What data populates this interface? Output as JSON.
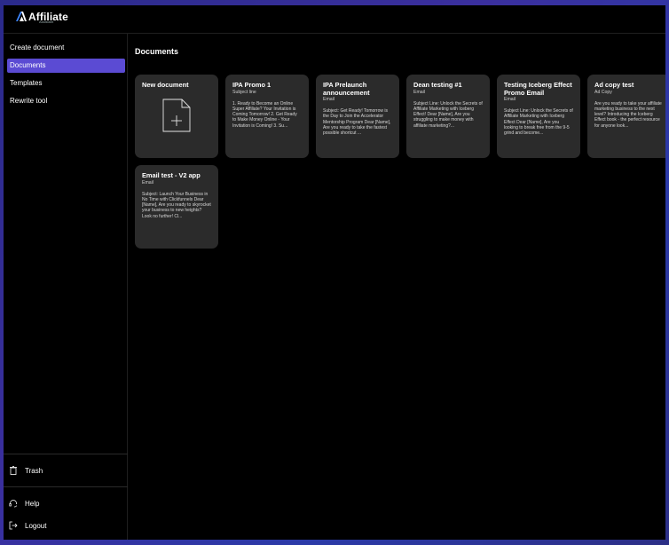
{
  "app": {
    "logo_text": "Affiliate",
    "logo_sub": "Assistant"
  },
  "sidebar": {
    "items": [
      {
        "label": "Create document",
        "active": false
      },
      {
        "label": "Documents",
        "active": true
      },
      {
        "label": "Templates",
        "active": false
      },
      {
        "label": "Rewrite tool",
        "active": false
      }
    ],
    "bottom": {
      "trash": "Trash",
      "help": "Help",
      "logout": "Logout"
    }
  },
  "main": {
    "title": "Documents",
    "new_document_label": "New document",
    "cards": [
      {
        "title": "IPA Promo 1",
        "type": "Subject line",
        "body": "1. Ready to Become an Online Super Affiliate? Your Invitation is Coming Tomorrow! 2. Get Ready to Make Money Online - Your Invitation is Coming! 3. Su..."
      },
      {
        "title": "IPA Prelaunch announcement",
        "type": "Email",
        "body": "Subject: Get Ready! Tomorrow is the Day to Join the Accelerator Mentorship Program Dear [Name], Are you ready to take the fastest possible shortcut ..."
      },
      {
        "title": "Dean testing #1",
        "type": "Email",
        "body": "Subject Line: Unlock the Secrets of Affiliate Marketing with Iceberg Effect! Dear [Name], Are you struggling to make money with affiliate marketing?..."
      },
      {
        "title": "Testing Iceberg Effect Promo Email",
        "type": "Email",
        "body": "Subject Line: Unlock the Secrets of Affiliate Marketing with Iceberg Effect Dear [Name], Are you looking to break free from the 9-5 grind and become..."
      },
      {
        "title": "Ad copy test",
        "type": "Ad Copy",
        "body": "Are you ready to take your affiliate marketing business to the next level? Introducing the Iceberg Effect book - the perfect resource for anyone look..."
      },
      {
        "title": "Email test - V2 app",
        "type": "Email",
        "body": "Subject: Launch Your Business in No Time with Clickfunnels Dear [Name], Are you ready to skyrocket your business to new heights? Look no further! Cl..."
      }
    ]
  },
  "colors": {
    "accent": "#5b4bd3",
    "card_bg": "#2b2b2b",
    "app_bg": "#000000"
  }
}
